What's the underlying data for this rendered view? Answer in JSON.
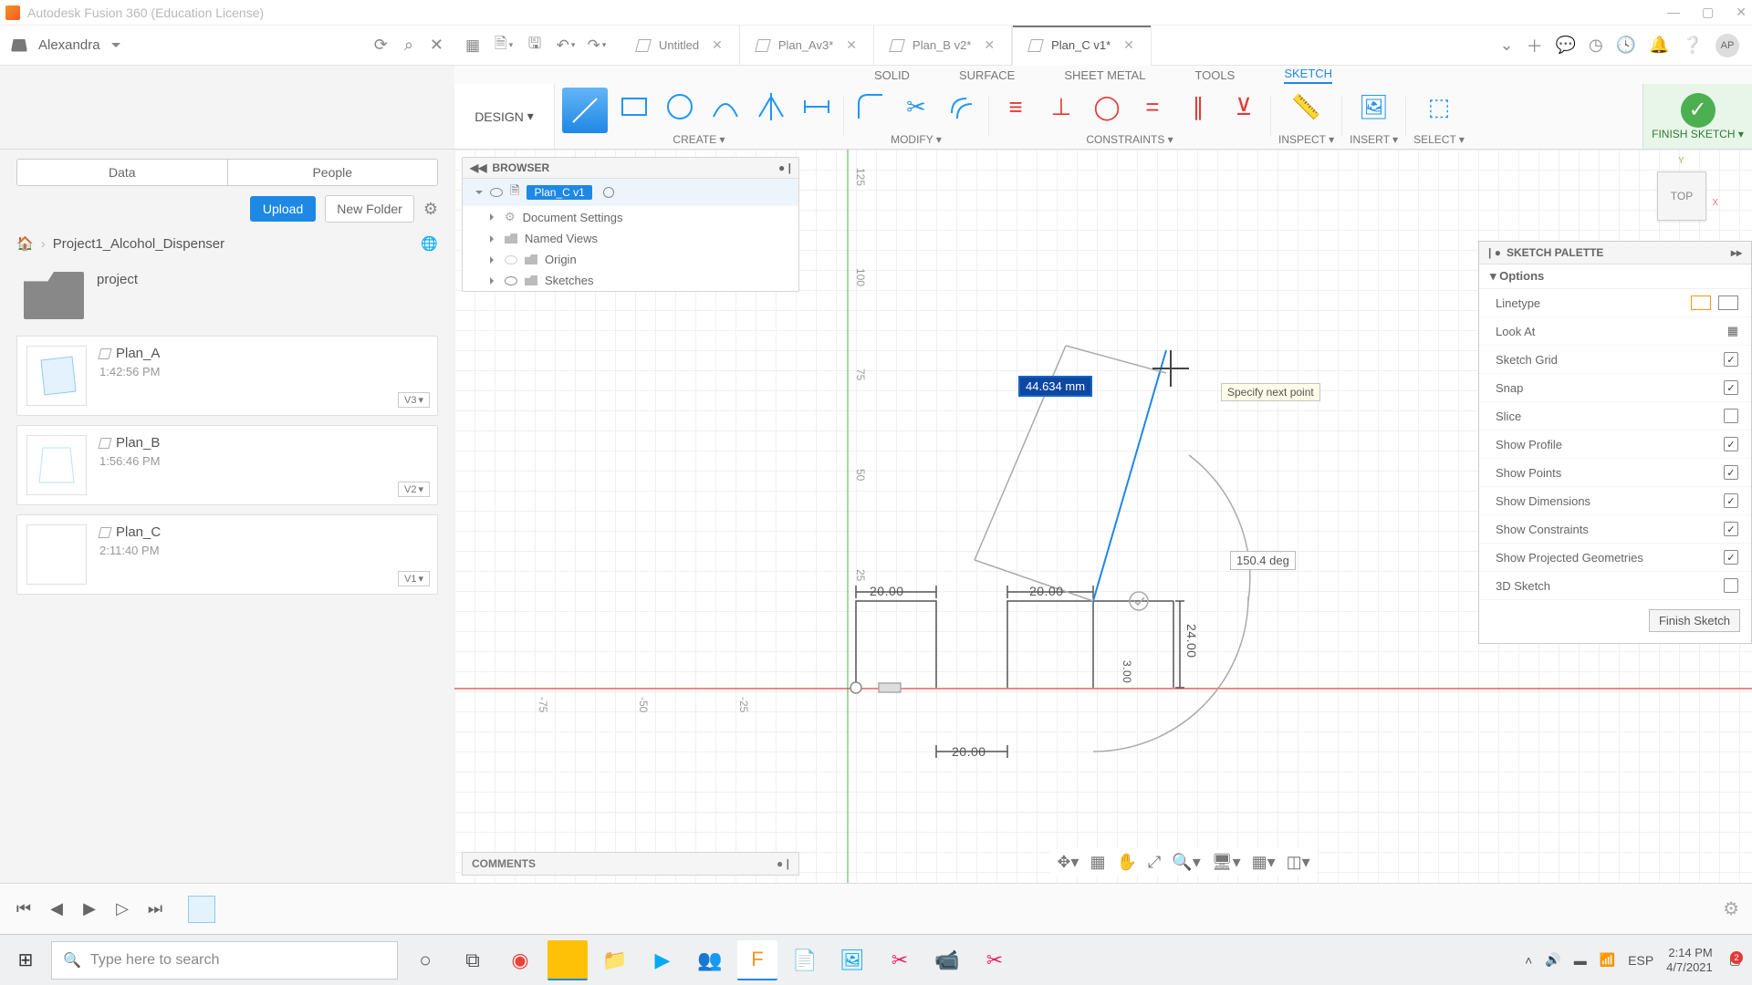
{
  "app": {
    "title": "Autodesk Fusion 360 (Education License)"
  },
  "user": {
    "name": "Alexandra",
    "initials": "AP"
  },
  "file_tabs": [
    {
      "label": "Untitled",
      "active": false
    },
    {
      "label": "Plan_Av3*",
      "active": false
    },
    {
      "label": "Plan_B v2*",
      "active": false
    },
    {
      "label": "Plan_C v1*",
      "active": true
    }
  ],
  "ribbon": {
    "workspace": "DESIGN",
    "tabs": [
      "SOLID",
      "SURFACE",
      "SHEET METAL",
      "TOOLS",
      "SKETCH"
    ],
    "active_tab": "SKETCH",
    "groups": {
      "create": "CREATE ▾",
      "modify": "MODIFY ▾",
      "constraints": "CONSTRAINTS ▾",
      "inspect": "INSPECT ▾",
      "insert": "INSERT ▾",
      "select": "SELECT ▾",
      "finish": "FINISH SKETCH ▾"
    }
  },
  "data_panel": {
    "seg": {
      "data": "Data",
      "people": "People"
    },
    "upload": "Upload",
    "new_folder": "New Folder",
    "breadcrumb": "Project1_Alcohol_Dispenser",
    "folder": "project",
    "files": [
      {
        "name": "Plan_A",
        "time": "1:42:56 PM",
        "ver": "V3"
      },
      {
        "name": "Plan_B",
        "time": "1:56:46 PM",
        "ver": "V2"
      },
      {
        "name": "Plan_C",
        "time": "2:11:40 PM",
        "ver": "V1"
      }
    ]
  },
  "browser": {
    "title": "BROWSER",
    "root": "Plan_C v1",
    "items": [
      "Document Settings",
      "Named Views",
      "Origin",
      "Sketches"
    ]
  },
  "palette": {
    "title": "SKETCH PALETTE",
    "section": "Options",
    "rows": [
      {
        "label": "Linetype",
        "type": "linetype"
      },
      {
        "label": "Look At",
        "type": "icon"
      },
      {
        "label": "Sketch Grid",
        "type": "check",
        "checked": true
      },
      {
        "label": "Snap",
        "type": "check",
        "checked": true
      },
      {
        "label": "Slice",
        "type": "check",
        "checked": false
      },
      {
        "label": "Show Profile",
        "type": "check",
        "checked": true
      },
      {
        "label": "Show Points",
        "type": "check",
        "checked": true
      },
      {
        "label": "Show Dimensions",
        "type": "check",
        "checked": true
      },
      {
        "label": "Show Constraints",
        "type": "check",
        "checked": true
      },
      {
        "label": "Show Projected Geometries",
        "type": "check",
        "checked": true
      },
      {
        "label": "3D Sketch",
        "type": "check",
        "checked": false
      }
    ],
    "finish": "Finish Sketch"
  },
  "canvas": {
    "dim_input": "44.634 mm",
    "tooltip": "Specify next point",
    "angle": "150.4 deg",
    "dims": {
      "d20a": "20.00",
      "d20b": "20.00",
      "d20c": "20.00",
      "d24": "24.00",
      "d3": "3.00"
    },
    "viewcube": "TOP",
    "ticks_y": [
      "125",
      "100",
      "75",
      "50",
      "25"
    ],
    "ticks_x": [
      "-75",
      "-50",
      "-25"
    ]
  },
  "comments": "COMMENTS",
  "taskbar": {
    "search_placeholder": "Type here to search",
    "lang": "ESP",
    "time": "2:14 PM",
    "date": "4/7/2021",
    "notif": "2"
  }
}
